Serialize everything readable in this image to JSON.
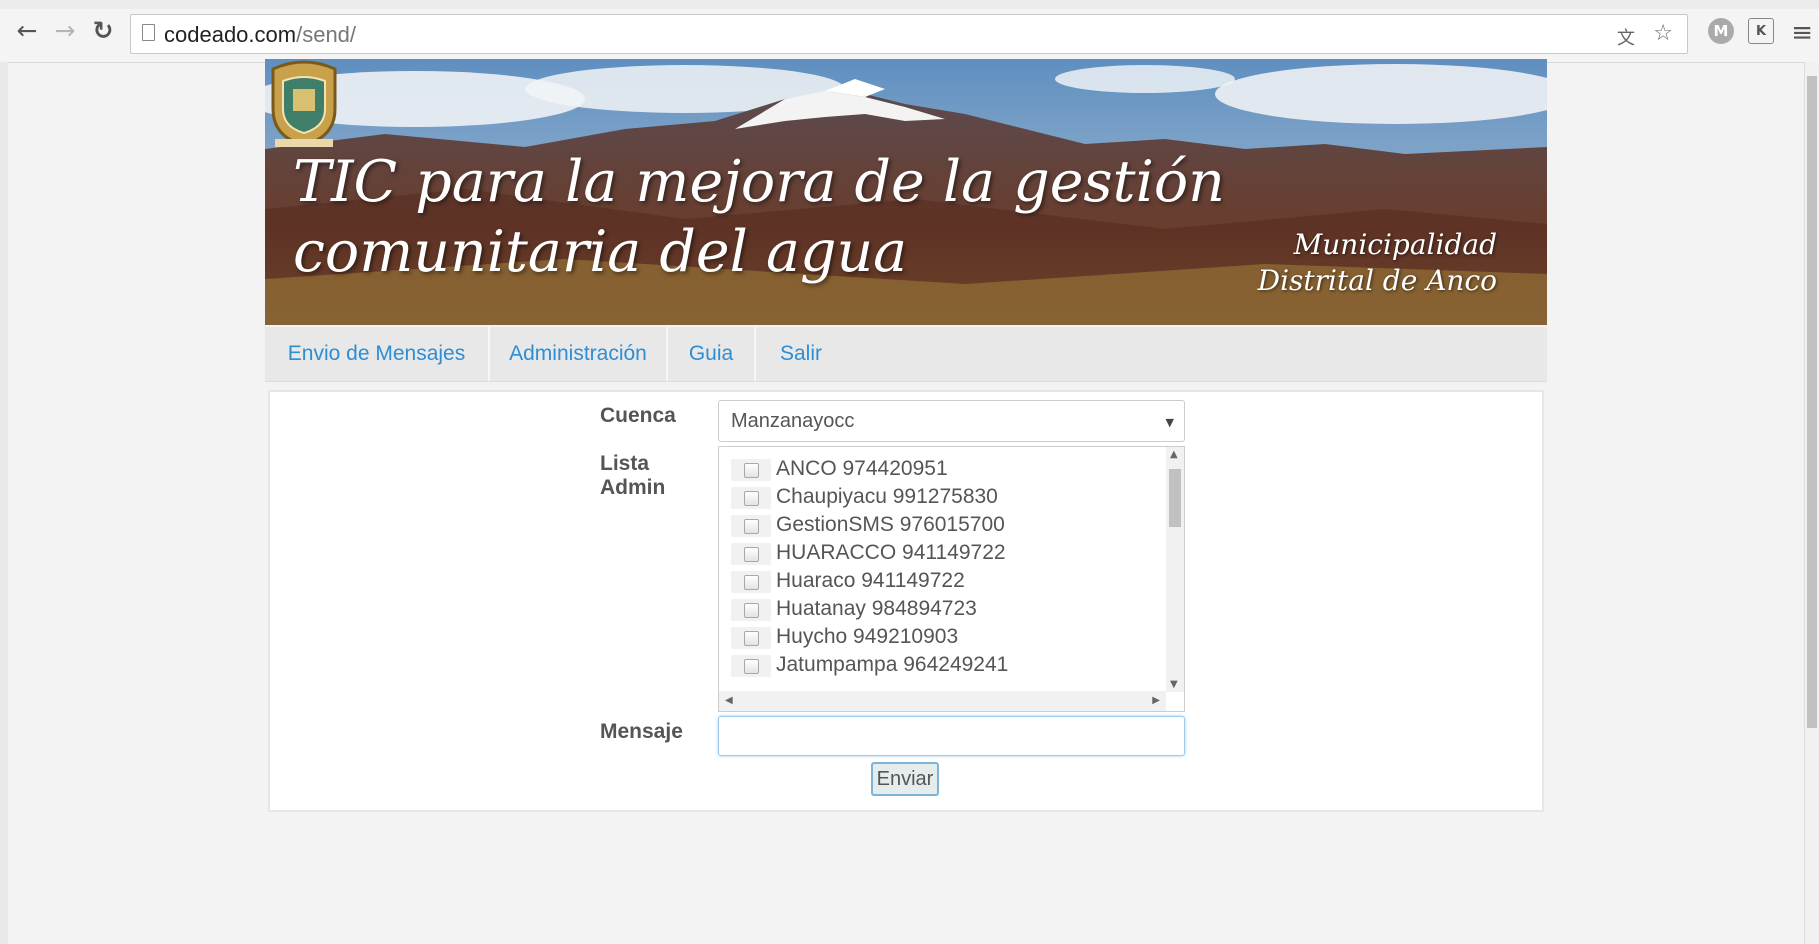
{
  "browser": {
    "url_host": "codeado.com",
    "url_path": "/send/"
  },
  "banner": {
    "title_line1": "TIC para la mejora de la gestión",
    "title_line2": "comunitaria del agua",
    "municipality_line1": "Municipalidad",
    "municipality_line2": "Distrital de Anco"
  },
  "nav": {
    "items": [
      {
        "label": "Envio de Mensajes"
      },
      {
        "label": "Administración"
      },
      {
        "label": "Guia"
      },
      {
        "label": "Salir"
      }
    ]
  },
  "form": {
    "cuenca_label": "Cuenca",
    "cuenca_value": "Manzanayocc",
    "lista_label_line1": "Lista",
    "lista_label_line2": "Admin",
    "admins": [
      {
        "label": "ANCO 974420951",
        "checked": false
      },
      {
        "label": "Chaupiyacu 991275830",
        "checked": false
      },
      {
        "label": "GestionSMS 976015700",
        "checked": false
      },
      {
        "label": "HUARACCO 941149722",
        "checked": false
      },
      {
        "label": "Huaraco 941149722",
        "checked": false
      },
      {
        "label": "Huatanay 984894723",
        "checked": false
      },
      {
        "label": "Huycho 949210903",
        "checked": false
      },
      {
        "label": "Jatumpampa 964249241",
        "checked": false
      }
    ],
    "mensaje_label": "Mensaje",
    "mensaje_value": "",
    "send_label": "Enviar"
  },
  "colors": {
    "link": "#2d8ed4",
    "nav_bg": "#e8e8e8",
    "label": "#555555"
  }
}
